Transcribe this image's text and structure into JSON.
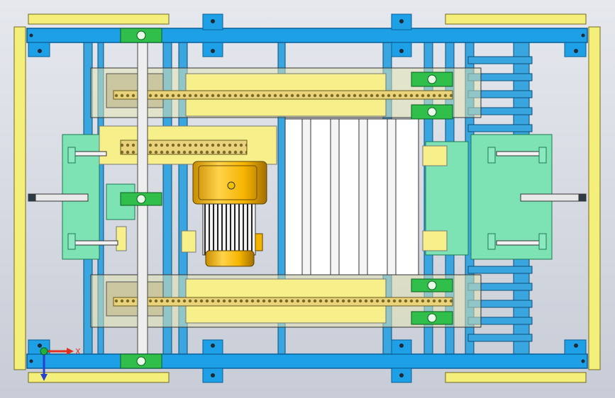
{
  "viewport": {
    "background_top": "#e6e8ee",
    "background_bottom": "#c7ccd6"
  },
  "colors": {
    "frame_yellow": "#f4ee7a",
    "frame_yellow_edge": "#8a8425",
    "beam_blue": "#1ea0e6",
    "beam_blue_dark": "#0a5f98",
    "rail_blue": "#3aa6e0",
    "mint": "#7de3b5",
    "green_bearing": "#2fbf4a",
    "motor_gold": "#f5b400",
    "motor_gold_dark": "#a36f00",
    "white_panel": "#ffffff",
    "chain": "#b9a25c",
    "gray_glass": "#9aa0a0",
    "dark_gray": "#3c4a57"
  },
  "triad": {
    "x_label": "X",
    "axis_x_color": "#e03020",
    "axis_y_color": "#2840d0",
    "origin_color": "#20b040"
  }
}
